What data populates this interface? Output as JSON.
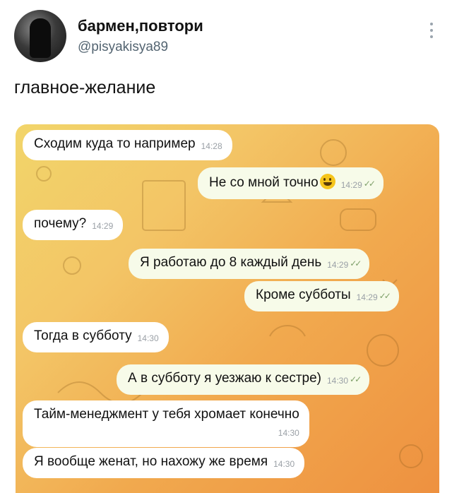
{
  "tweet": {
    "display_name": "бармен,повтори",
    "handle": "@pisyakisya89",
    "text": "главное-желание"
  },
  "chat": {
    "messages": [
      {
        "text": "Сходим куда то например",
        "time": "14:28",
        "side": "in"
      },
      {
        "text": "Не со мной точно",
        "time": "14:29",
        "side": "out",
        "emoji": "grinning-face"
      },
      {
        "text": "почему?",
        "time": "14:29",
        "side": "in"
      },
      {
        "text": "Я работаю до 8 каждый день",
        "time": "14:29",
        "side": "out"
      },
      {
        "text": "Кроме субботы",
        "time": "14:29",
        "side": "out"
      },
      {
        "text": "Тогда в субботу",
        "time": "14:30",
        "side": "in"
      },
      {
        "text": "А в субботу я уезжаю к сестре)",
        "time": "14:30",
        "side": "out"
      },
      {
        "text": "Тайм-менеджмент у тебя хромает конечно",
        "time": "14:30",
        "side": "in"
      },
      {
        "text": "Я вообще женат, но нахожу же время",
        "time": "14:30",
        "side": "in"
      }
    ],
    "read_checks": "✓✓"
  },
  "colors": {
    "chat_bg_start": "#f2d56a",
    "chat_bg_end": "#ee9140",
    "outgoing_bubble": "#f7fbe9",
    "incoming_bubble": "#ffffff"
  }
}
